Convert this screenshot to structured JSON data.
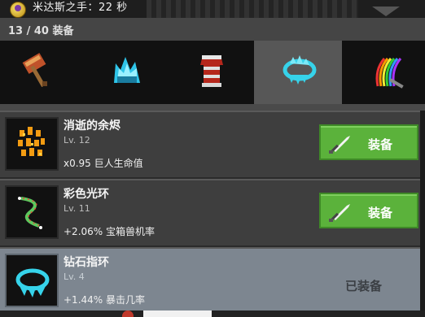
{
  "buff": {
    "text": "米达斯之手：22 秒",
    "icon": "coin-icon"
  },
  "inventory": {
    "counter": "13 / 40 装备"
  },
  "tabs": [
    {
      "id": "weapon",
      "icon": "hammer-icon"
    },
    {
      "id": "helmet",
      "icon": "ice-helmet-icon"
    },
    {
      "id": "armor",
      "icon": "armor-icon"
    },
    {
      "id": "ring",
      "icon": "ring-icon",
      "active": true
    },
    {
      "id": "cape",
      "icon": "rainbow-sword-icon"
    }
  ],
  "items": [
    {
      "name": "消逝的余烬",
      "level": "Lv. 12",
      "stat": "x0.95 巨人生命值",
      "action": "装备",
      "equipped": false,
      "icon": "ember-icon"
    },
    {
      "name": "彩色光环",
      "level": "Lv. 11",
      "stat": "+2.06% 宝箱兽机率",
      "action": "装备",
      "equipped": false,
      "icon": "rainbow-aura-icon"
    },
    {
      "name": "钻石指环",
      "level": "Lv. 4",
      "stat": "+1.44% 暴击几率",
      "action": "已装备",
      "equipped": true,
      "icon": "diamond-ring-icon"
    }
  ],
  "colors": {
    "equip_button": "#5bb23b",
    "equipped_row": "#7d8690",
    "active_tab": "#575757"
  }
}
